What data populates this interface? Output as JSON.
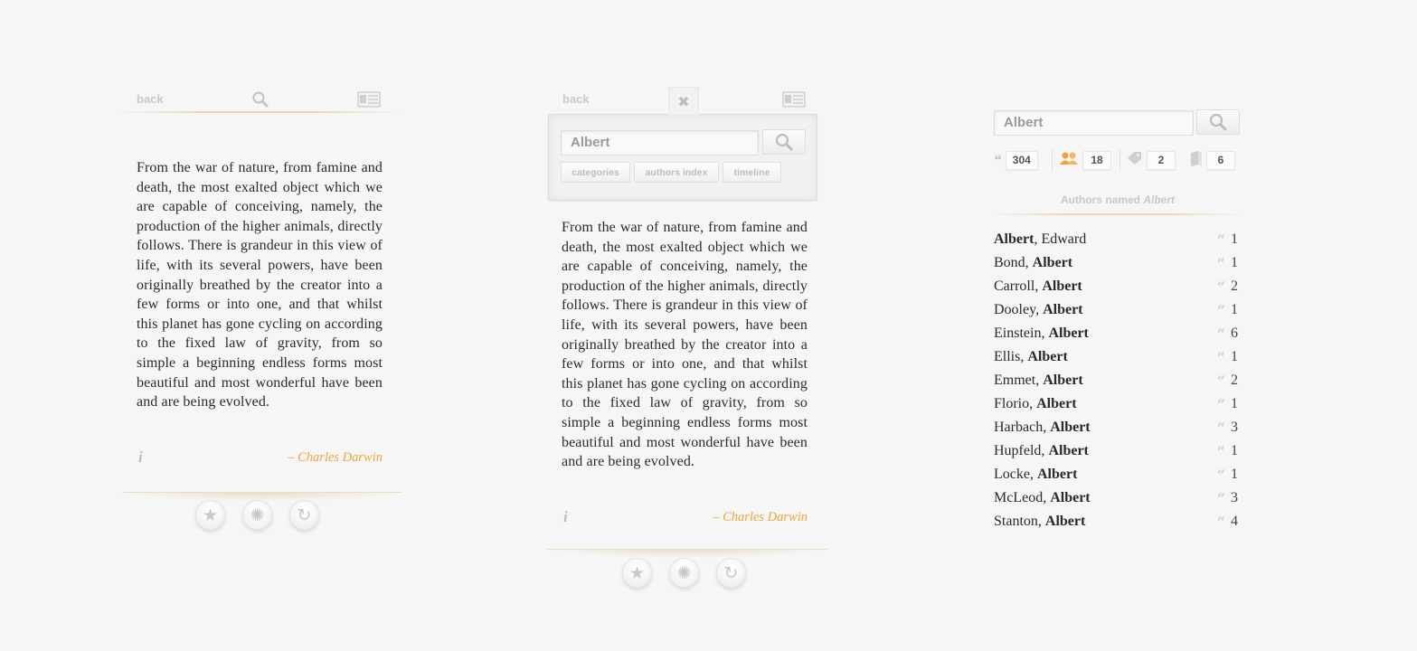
{
  "header": {
    "back_label": "back"
  },
  "quote": {
    "text": "From the war of nature, from famine and death, the most exalted object which we are capable of conceiving, namely, the production of the higher animals, directly follows. There is grandeur in this view of life, with its several powers, have been originally breathed by the creator into a few forms or into one, and that whilst this planet has gone cycling on according to the fixed law of gravity, from so simple a beginning endless forms most beautiful and most wonderful have been and are being evolved.",
    "author": "– Charles Darwin",
    "info_icon": "i"
  },
  "search": {
    "value": "Albert",
    "close_icon": "✖",
    "pills": [
      "categories",
      "authors index",
      "timeline"
    ]
  },
  "results": {
    "stats": [
      {
        "icon": "quote-icon",
        "count": "304"
      },
      {
        "icon": "authors-icon",
        "count": "18"
      },
      {
        "icon": "tag-icon",
        "count": "2"
      },
      {
        "icon": "book-icon",
        "count": "6"
      }
    ],
    "title_prefix": "Authors named",
    "title_term": "Albert",
    "list": [
      {
        "first": "Albert",
        "first_bold": true,
        "rest": ", Edward",
        "count": "1"
      },
      {
        "first": "Bond, ",
        "first_bold": false,
        "rest": "Albert",
        "count": "1"
      },
      {
        "first": "Carroll, ",
        "first_bold": false,
        "rest": "Albert",
        "count": "2"
      },
      {
        "first": "Dooley, ",
        "first_bold": false,
        "rest": "Albert",
        "count": "1"
      },
      {
        "first": "Einstein, ",
        "first_bold": false,
        "rest": "Albert",
        "count": "6"
      },
      {
        "first": "Ellis, ",
        "first_bold": false,
        "rest": "Albert",
        "count": "1"
      },
      {
        "first": "Emmet, ",
        "first_bold": false,
        "rest": "Albert",
        "count": "2"
      },
      {
        "first": "Florio, ",
        "first_bold": false,
        "rest": "Albert",
        "count": "1"
      },
      {
        "first": "Harbach, ",
        "first_bold": false,
        "rest": "Albert",
        "count": "3"
      },
      {
        "first": "Hupfeld, ",
        "first_bold": false,
        "rest": "Albert",
        "count": "1"
      },
      {
        "first": "Locke, ",
        "first_bold": false,
        "rest": "Albert",
        "count": "1"
      },
      {
        "first": "McLeod, ",
        "first_bold": false,
        "rest": "Albert",
        "count": "3"
      },
      {
        "first": "Stanton, ",
        "first_bold": false,
        "rest": "Albert",
        "count": "4"
      }
    ]
  },
  "bottom_buttons": [
    {
      "name": "favorite-star-icon",
      "glyph": "★"
    },
    {
      "name": "random-swirl-icon",
      "glyph": "✺"
    },
    {
      "name": "refresh-icon",
      "glyph": "↻"
    }
  ],
  "colors": {
    "accent": "#f0a33c",
    "background": "#f6f6f6",
    "divider": "#ead7b5"
  }
}
